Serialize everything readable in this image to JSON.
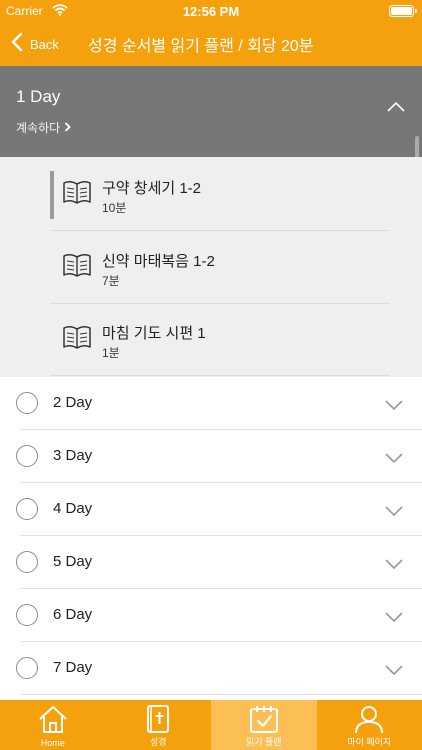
{
  "status": {
    "carrier": "Carrier",
    "time": "12:56 PM"
  },
  "nav": {
    "back_label": "Back",
    "title": "성경 순서별 읽기 플랜 / 회당 20분"
  },
  "expanded_day": {
    "label": "1 Day",
    "continue_label": "계속하다"
  },
  "readings": [
    {
      "title": "구약 창세기 1-2",
      "time": "10분"
    },
    {
      "title": "신약 마태복음 1-2",
      "time": "7분"
    },
    {
      "title": "마침 기도 시편 1",
      "time": "1분"
    }
  ],
  "days": [
    "2 Day",
    "3 Day",
    "4 Day",
    "5 Day",
    "6 Day",
    "7 Day"
  ],
  "tabs": [
    {
      "label": "Home",
      "icon": "home-icon"
    },
    {
      "label": "성경",
      "icon": "bible-icon"
    },
    {
      "label": "읽기 플랜",
      "icon": "calendar-check-icon"
    },
    {
      "label": "마이 페이지",
      "icon": "user-icon"
    }
  ],
  "colors": {
    "accent": "#F5A10E",
    "expanded_bg": "#777777",
    "readings_bg": "#EFEFEF",
    "active_tab": "#FBBF55"
  }
}
